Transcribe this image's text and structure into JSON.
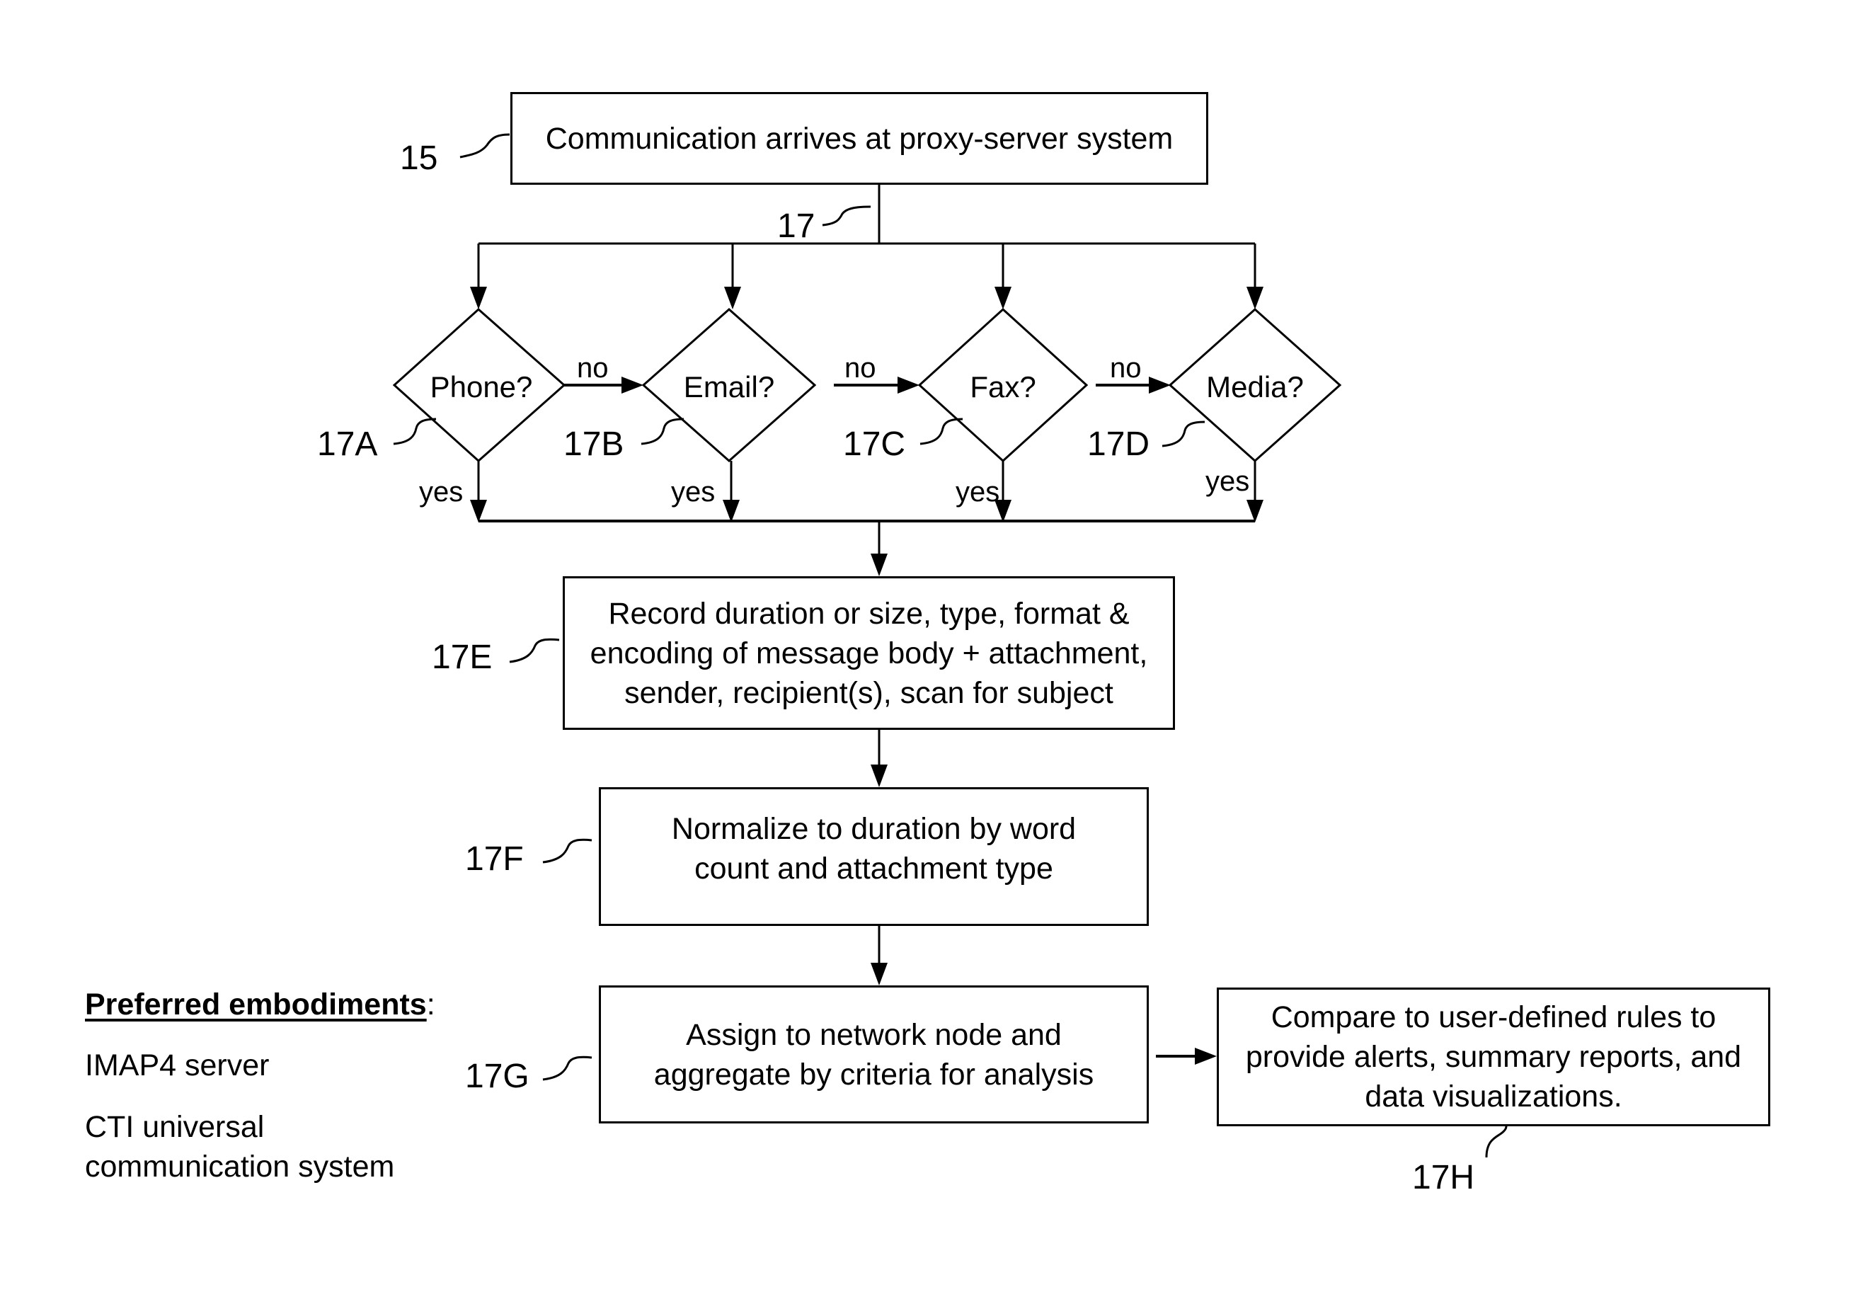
{
  "colors": {
    "ink": "#000000",
    "paper": "#ffffff"
  },
  "nodes": {
    "start": {
      "ref": "15",
      "text": "Communication arrives at proxy-server system"
    },
    "branch": {
      "ref": "17"
    },
    "phone": {
      "ref": "17A",
      "text": "Phone?"
    },
    "email": {
      "ref": "17B",
      "text": "Email?"
    },
    "fax": {
      "ref": "17C",
      "text": "Fax?"
    },
    "media": {
      "ref": "17D",
      "text": "Media?"
    },
    "record": {
      "ref": "17E",
      "lines": [
        "Record duration or size, type, format &",
        "encoding of message body + attachment,",
        "sender, recipient(s), scan for subject"
      ]
    },
    "normalize": {
      "ref": "17F",
      "lines": [
        "Normalize to duration by word",
        "count and attachment type"
      ]
    },
    "assign": {
      "ref": "17G",
      "lines": [
        "Assign to network node and",
        "aggregate by criteria for analysis"
      ]
    },
    "compare": {
      "ref": "17H",
      "lines": [
        "Compare to user-defined rules to",
        "provide alerts, summary reports, and",
        "data visualizations."
      ]
    }
  },
  "edge_labels": {
    "no": "no",
    "yes": "yes"
  },
  "preferred": {
    "title": "Preferred embodiments",
    "colon": ":",
    "items": [
      "IMAP4 server",
      "CTI universal",
      "communication system"
    ]
  }
}
